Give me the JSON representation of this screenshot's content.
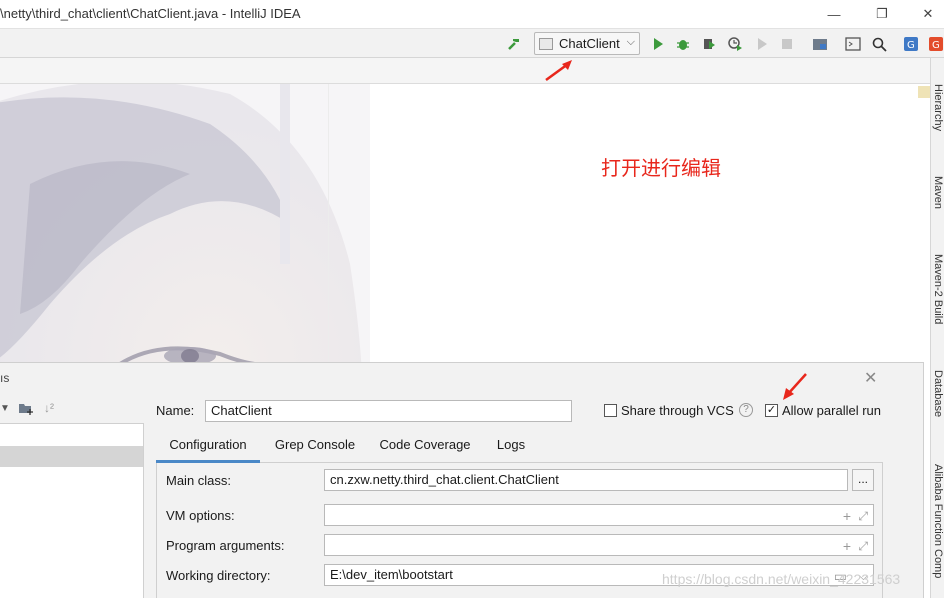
{
  "window": {
    "title": "\\netty\\third_chat\\client\\ChatClient.java - IntelliJ IDEA",
    "minimize": "—",
    "restore": "❐",
    "close": "✕"
  },
  "toolbar": {
    "run_config_label": "ChatClient",
    "icons": [
      "build-hammer-icon",
      "run-icon",
      "debug-icon",
      "coverage-icon",
      "profile-icon",
      "run-disabled-icon",
      "stop-icon",
      "project-structure-icon",
      "terminal-icon",
      "search-icon",
      "translate-icon",
      "plugin-icon"
    ]
  },
  "annotation": {
    "text": "打开进行编辑",
    "color": "#e8271c"
  },
  "right_strip": {
    "tabs": [
      "Hierarchy",
      "Maven",
      "Maven-2 Build",
      "Database",
      "Alibaba Function Comp"
    ]
  },
  "dialog": {
    "title_fragment": "ıs",
    "name_label": "Name:",
    "name_value": "ChatClient",
    "share_vcs_label": "Share through VCS",
    "allow_parallel_label": "Allow parallel run",
    "allow_parallel_checked": true,
    "tabs": [
      "Configuration",
      "Grep Console",
      "Code Coverage",
      "Logs"
    ],
    "active_tab": "Configuration",
    "fields": {
      "main_class_label": "Main class:",
      "main_class_value": "cn.zxw.netty.third_chat.client.ChatClient",
      "vm_options_label": "VM options:",
      "vm_options_value": "",
      "program_args_label": "Program arguments:",
      "program_args_value": "",
      "working_dir_label": "Working directory:",
      "working_dir_value": "E:\\dev_item\\bootstart"
    },
    "browse_label": "...",
    "watermark": "https://blog.csdn.net/weixin_42231563"
  },
  "colors": {
    "accent_tab": "#4a88c7",
    "run_green": "#3c9a3c",
    "annotation_red": "#e8271c"
  }
}
